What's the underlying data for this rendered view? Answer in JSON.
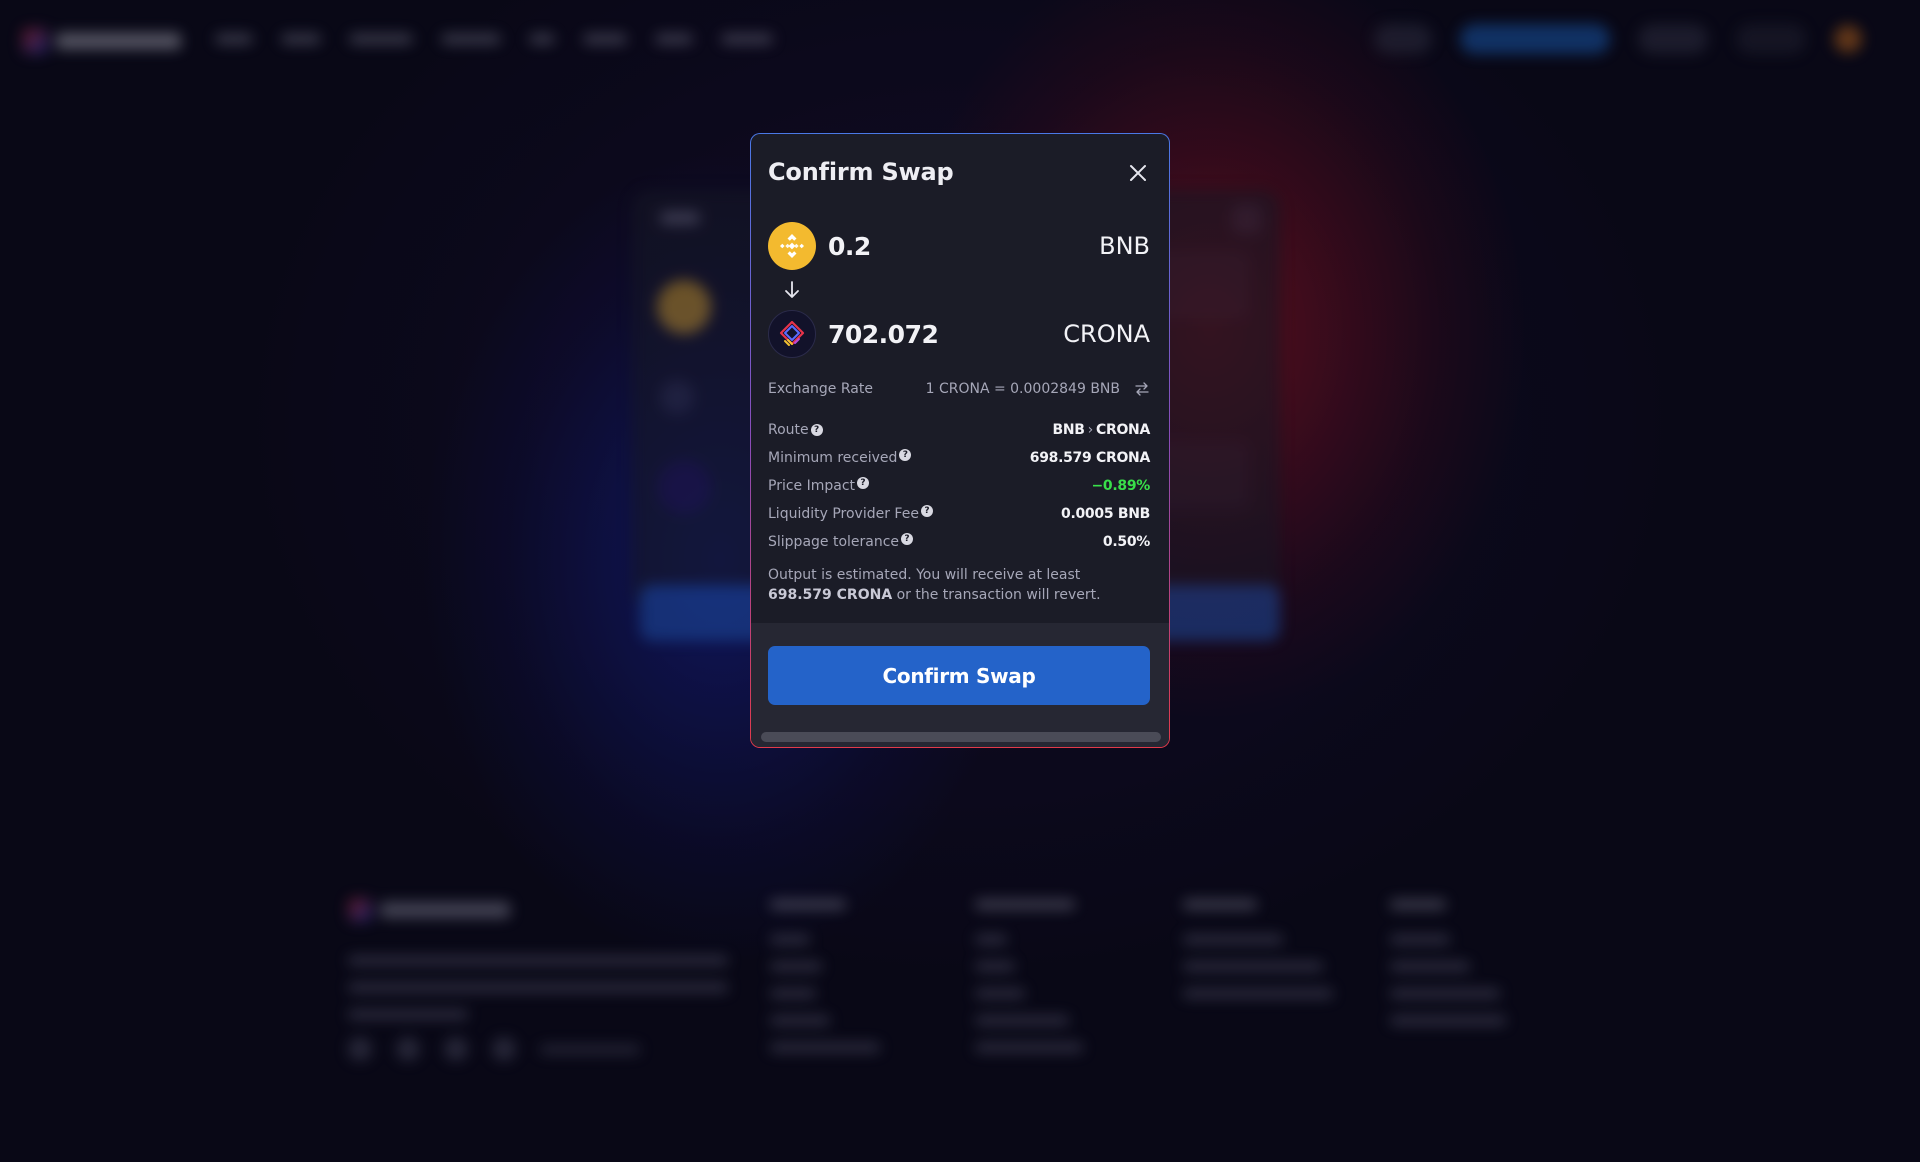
{
  "modal": {
    "title": "Confirm Swap",
    "close_icon": "close-icon",
    "from_token": {
      "amount": "0.2",
      "symbol": "BNB",
      "icon": "bnb-token-icon",
      "color": "#f3ba2f"
    },
    "to_token": {
      "amount": "702.072",
      "symbol": "CRONA",
      "icon": "crona-token-icon"
    },
    "arrow_icon": "arrow-down-icon",
    "exchange_rate": {
      "label": "Exchange Rate",
      "value": "1 CRONA = 0.0002849 BNB",
      "toggle_icon": "swap-arrows-icon"
    },
    "details": {
      "route_label": "Route",
      "route_from": "BNB",
      "route_sep": "›",
      "route_to": "CRONA",
      "min_received_label": "Minimum received",
      "min_received_value": "698.579 CRONA",
      "price_impact_label": "Price Impact",
      "price_impact_value": "−0.89%",
      "lp_fee_label": "Liquidity Provider Fee",
      "lp_fee_value": "0.0005 BNB",
      "slippage_label": "Slippage tolerance",
      "slippage_value": "0.50%",
      "help_glyph": "?"
    },
    "note": {
      "prefix": "Output is estimated. You will receive at least ",
      "amount": "698.579 CRONA",
      "suffix": " or the transaction will revert."
    },
    "confirm_label": "Confirm Swap"
  },
  "colors": {
    "accent_blue": "#2463c9",
    "positive_green": "#39e04a",
    "bnb_yellow": "#f3ba2f",
    "modal_bg": "#1b1c27"
  }
}
